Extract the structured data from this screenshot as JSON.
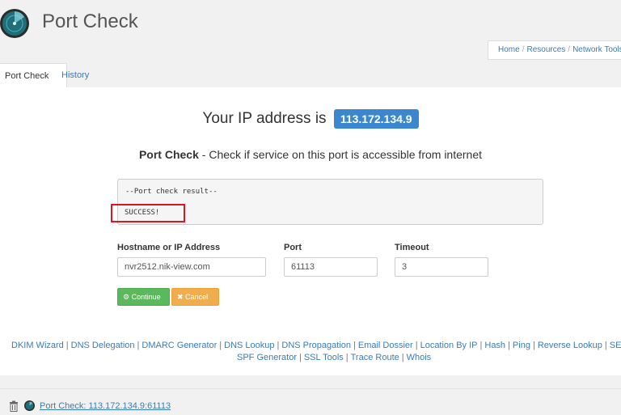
{
  "header": {
    "title": "Port Check",
    "breadcrumb": [
      "Home",
      "Resources",
      "Network Tools"
    ]
  },
  "tabs": [
    {
      "label": "Port Check",
      "active": true
    },
    {
      "label": "History",
      "active": false
    }
  ],
  "ip": {
    "prefix": "Your IP address is",
    "value": "113.172.134.9"
  },
  "subtitle": {
    "bold": "Port Check",
    "rest": " - Check if service on this port is accessible from internet"
  },
  "result": {
    "line1": "--Port check result--",
    "line2": "SUCCESS!"
  },
  "form": {
    "hostname_label": "Hostname or IP Address",
    "hostname_value": "nvr2512.nik-view.com",
    "port_label": "Port",
    "port_value": "61113",
    "timeout_label": "Timeout",
    "timeout_value": "3"
  },
  "buttons": {
    "continue": "Continue",
    "cancel": "Cancel"
  },
  "footer": {
    "row1": [
      "DKIM Wizard",
      "DNS Delegation",
      "DMARC Generator",
      "DNS Lookup",
      "DNS Propagation",
      "Email Dossier",
      "Location By IP",
      "Hash",
      "Ping",
      "Reverse Lookup",
      "SEO An"
    ],
    "row2": [
      "SPF Generator",
      "SSL Tools",
      "Trace Route",
      "Whois"
    ]
  },
  "history_item": "Port Check: 113.172.134.9:61113",
  "colors": {
    "accent": "#3a87d0",
    "link": "#3a7bb8",
    "success": "#5cb85c",
    "warning": "#f0ad4e",
    "highlight": "#e0141e"
  }
}
